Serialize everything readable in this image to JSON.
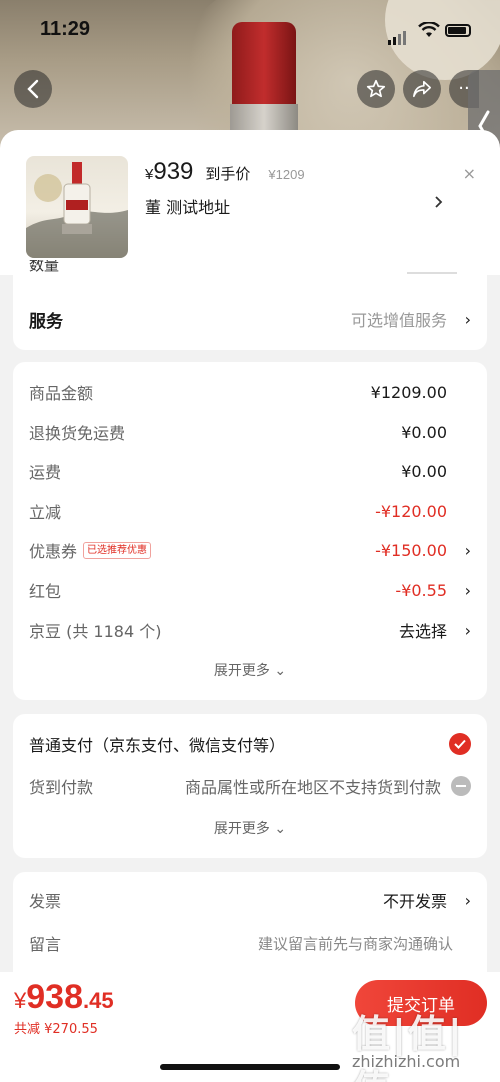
{
  "status": {
    "time": "11:29"
  },
  "product": {
    "yen": "¥",
    "price": "939",
    "price_tag": "到手价",
    "original_price": "¥1209",
    "close": "×",
    "address": "董  测试地址"
  },
  "service_card": {
    "cut_label": "数量",
    "label": "服务",
    "value": "可选增值服务"
  },
  "price_card": {
    "rows": [
      {
        "label": "商品金额",
        "value": "¥1209.00"
      },
      {
        "label": "退换货免运费",
        "value": "¥0.00"
      },
      {
        "label": "运费",
        "value": "¥0.00"
      },
      {
        "label": "立减",
        "value": "-¥120.00"
      },
      {
        "label": "优惠券",
        "tag": "已选推荐优惠",
        "value": "-¥150.00"
      },
      {
        "label": "红包",
        "value": "-¥0.55"
      },
      {
        "label": "京豆 (共 1184 个)",
        "value": "去选择"
      }
    ],
    "more": "展开更多"
  },
  "payment_card": {
    "normal_pay": "普通支付（京东支付、微信支付等）",
    "cod_label": "货到付款",
    "cod_note": "商品属性或所在地区不支持货到付款",
    "more": "展开更多"
  },
  "invoice_card": {
    "invoice_label": "发票",
    "invoice_value": "不开发票",
    "note_label": "留言",
    "note_placeholder": "建议留言前先与商家沟通确认"
  },
  "bottom_bar": {
    "yen": "¥",
    "total_int": "938",
    "total_dec": ".45",
    "saved": "共减 ¥270.55",
    "submit": "提交订单"
  },
  "watermark": {
    "logo": "值|值|值",
    "site": "zhizhizhi.com"
  },
  "colors": {
    "accent": "#e02e24"
  }
}
